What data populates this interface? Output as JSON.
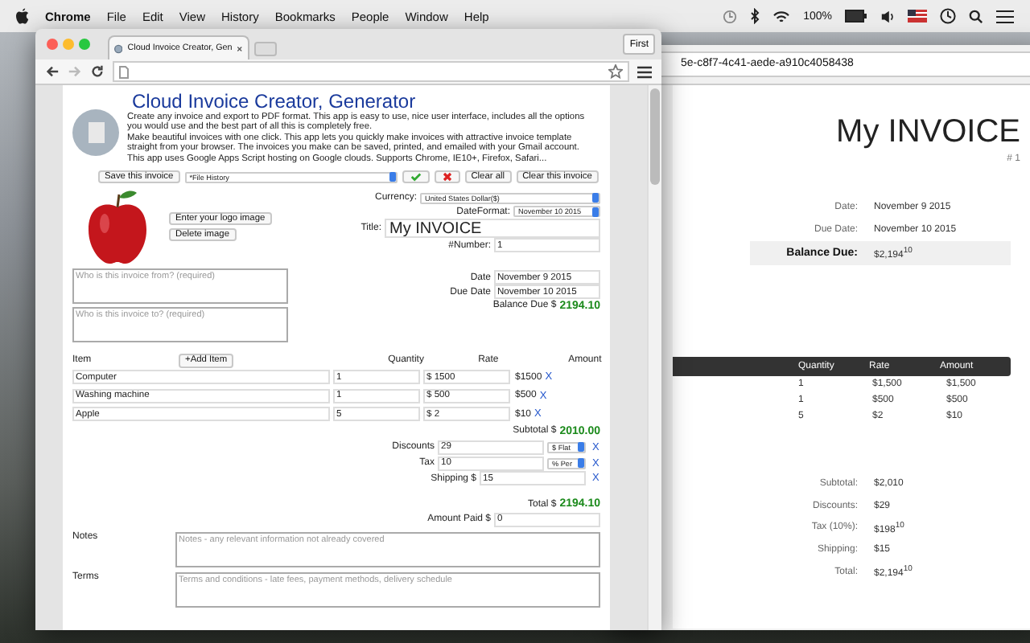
{
  "menubar": {
    "app": "Chrome",
    "menus": [
      "File",
      "Edit",
      "View",
      "History",
      "Bookmarks",
      "People",
      "Window",
      "Help"
    ],
    "battery": "100%"
  },
  "back_window": {
    "url": "5e-c8f7-4c41-aede-a910c4058438",
    "preview": {
      "title": "My INVOICE",
      "number": "# 1",
      "meta": [
        {
          "label": "Date:",
          "value": "November 9 2015"
        },
        {
          "label": "Due Date:",
          "value": "November 10 2015"
        }
      ],
      "balance": {
        "label": "Balance Due:",
        "value": "$2,194$^{10}$"
      },
      "columns": [
        "Quantity",
        "Rate",
        "Amount"
      ],
      "rows": [
        [
          "1",
          "$1,500",
          "$1,500"
        ],
        [
          "1",
          "$500",
          "$500"
        ],
        [
          "5",
          "$2",
          "$10"
        ]
      ],
      "totals": [
        {
          "label": "Subtotal:",
          "value": "$2,010"
        },
        {
          "label": "Discounts:",
          "value": "$29"
        },
        {
          "label": "Tax (10%):",
          "value": "$198$^{10}$"
        },
        {
          "label": "Shipping:",
          "value": "$15"
        },
        {
          "label": "Total:",
          "value": "$2,194$^{10}$"
        }
      ]
    }
  },
  "front_window": {
    "tab_title": "Cloud Invoice Creator, Gen",
    "profile": "First",
    "app": {
      "title": "Cloud Invoice Creator, Generator",
      "description": [
        "Create any invoice and export to PDF format. This app is easy to use, nice user interface, includes all the options you would use and the best part of all this is completely free.",
        "Make beautiful invoices with one click. This app lets you quickly make invoices with attractive invoice template straight from your browser. The invoices you make can be saved, printed, and emailed with your Gmail account.",
        "This app uses Google Apps Script hosting on Google clouds. Supports Chrome, IE10+, Firefox, Safari..."
      ],
      "toolbar": {
        "save": "Save this invoice",
        "history": "*File History",
        "clear_all": "Clear all",
        "clear_invoice": "Clear this invoice"
      },
      "logo_buttons": [
        "Enter your logo image",
        "Delete image"
      ],
      "currency": {
        "label": "Currency:",
        "value": "United States Dollar($)"
      },
      "date_format": {
        "label": "DateFormat:",
        "value": "November 10 2015"
      },
      "invoice_title": {
        "label": "Title:",
        "value": "My INVOICE"
      },
      "number": {
        "label": "#Number:",
        "value": "1"
      },
      "from": {
        "placeholder": "Who is this invoice from? (required)"
      },
      "to": {
        "placeholder": "Who is this invoice to? (required)"
      },
      "dates": [
        {
          "label": "Date",
          "value": "November 9 2015"
        },
        {
          "label": "Due Date",
          "value": "November 10 2015"
        }
      ],
      "balance": {
        "label": "Balance Due $",
        "value": "2194.10"
      },
      "items_header": {
        "item": "Item",
        "add": "+Add Item",
        "quantity": "Quantity",
        "rate": "Rate",
        "amount": "Amount"
      },
      "items": [
        {
          "name": "Computer",
          "quantity": "1",
          "rate": "$ 1500",
          "amount": "$1500",
          "remove": "X"
        },
        {
          "name": "Washing machine",
          "quantity": "1",
          "rate": "$ 500",
          "amount": "$500",
          "remove": "X"
        },
        {
          "name": "Apple",
          "quantity": "5",
          "rate": "$ 2",
          "amount": "$10",
          "remove": "X"
        }
      ],
      "subtotal": {
        "label": "Subtotal $",
        "value": "2010.00"
      },
      "adjustments": [
        {
          "kind": "select",
          "label": "Discounts",
          "value": "29",
          "unit": "$ Flat",
          "remove": "X"
        },
        {
          "kind": "select",
          "label": "Tax",
          "value": "10",
          "unit": "% Per",
          "remove": "X"
        },
        {
          "kind": "prefixed",
          "label": "Shipping $",
          "value": "15",
          "remove": "X"
        }
      ],
      "total": {
        "label": "Total $",
        "value": "2194.10"
      },
      "amount_paid": {
        "label": "Amount Paid $",
        "value": "0"
      },
      "notes": {
        "label": "Notes",
        "placeholder": "Notes - any relevant information not already covered"
      },
      "terms": {
        "label": "Terms",
        "placeholder": "Terms and conditions - late fees, payment methods, delivery schedule"
      }
    }
  }
}
